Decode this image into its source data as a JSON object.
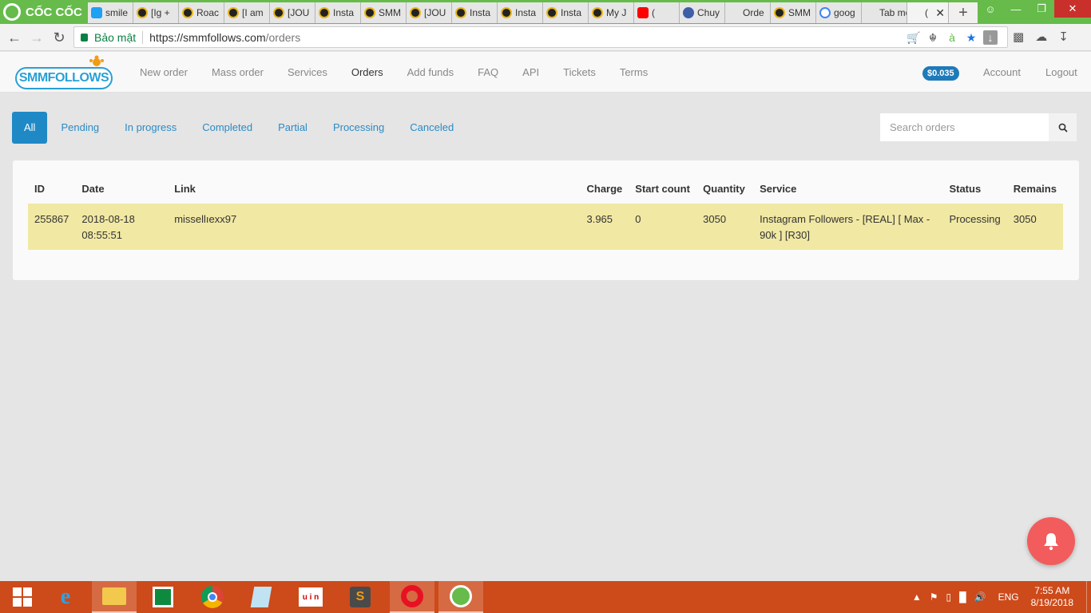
{
  "browser": {
    "brand": "CỐC CỐC",
    "tabs": [
      {
        "title": "smile",
        "icon": "twitter-icon"
      },
      {
        "title": "[Ig +",
        "icon": "site-icon"
      },
      {
        "title": "Roac",
        "icon": "site-icon"
      },
      {
        "title": "[I am",
        "icon": "site-icon"
      },
      {
        "title": "[JOU",
        "icon": "site-icon"
      },
      {
        "title": "Insta",
        "icon": "site-icon"
      },
      {
        "title": "SMM",
        "icon": "site-icon"
      },
      {
        "title": "[JOU",
        "icon": "site-icon"
      },
      {
        "title": "Insta",
        "icon": "site-icon"
      },
      {
        "title": "Insta",
        "icon": "site-icon"
      },
      {
        "title": "Insta",
        "icon": "site-icon"
      },
      {
        "title": "My J",
        "icon": "site-icon"
      },
      {
        "title": "(",
        "icon": "youtube-icon"
      },
      {
        "title": "Chuy",
        "icon": "vivaldi-icon"
      },
      {
        "title": "Orde",
        "icon": "blank-icon"
      },
      {
        "title": "SMM",
        "icon": "site-icon"
      },
      {
        "title": "goog",
        "icon": "google-icon"
      },
      {
        "title": "Tab mới",
        "icon": "blank-icon"
      },
      {
        "title": "(",
        "icon": "blank-icon",
        "active": true
      }
    ],
    "security_label": "Bảo mật",
    "url_host": "https://smmfollows.com",
    "url_path": "/orders"
  },
  "site": {
    "logo_text": "SMMFOLLOWS",
    "nav": [
      "New order",
      "Mass order",
      "Services",
      "Orders",
      "Add funds",
      "FAQ",
      "API",
      "Tickets",
      "Terms"
    ],
    "current_nav": "Orders",
    "balance": "$0.035",
    "account_label": "Account",
    "logout_label": "Logout"
  },
  "filters": {
    "items": [
      "All",
      "Pending",
      "In progress",
      "Completed",
      "Partial",
      "Processing",
      "Canceled"
    ],
    "active": "All",
    "search_placeholder": "Search orders"
  },
  "orders": {
    "columns": [
      "ID",
      "Date",
      "Link",
      "Charge",
      "Start count",
      "Quantity",
      "Service",
      "Status",
      "Remains"
    ],
    "rows": [
      {
        "id": "255867",
        "date": "2018-08-18",
        "time": "08:55:51",
        "link": "missellıexx97",
        "charge": "3.965",
        "start_count": "0",
        "quantity": "3050",
        "service": "Instagram Followers - [REAL] [ Max - 90k ] [R30]",
        "status": "Processing",
        "remains": "3050"
      }
    ]
  },
  "taskbar": {
    "language": "ENG",
    "time": "7:55 AM",
    "date": "8/19/2018"
  },
  "colors": {
    "tabbar": "#66bb4b",
    "accent_blue": "#1f89c6",
    "row_highlight": "#f1e8a3",
    "bell": "#f25c5c",
    "taskbar": "#cd4a1a"
  }
}
